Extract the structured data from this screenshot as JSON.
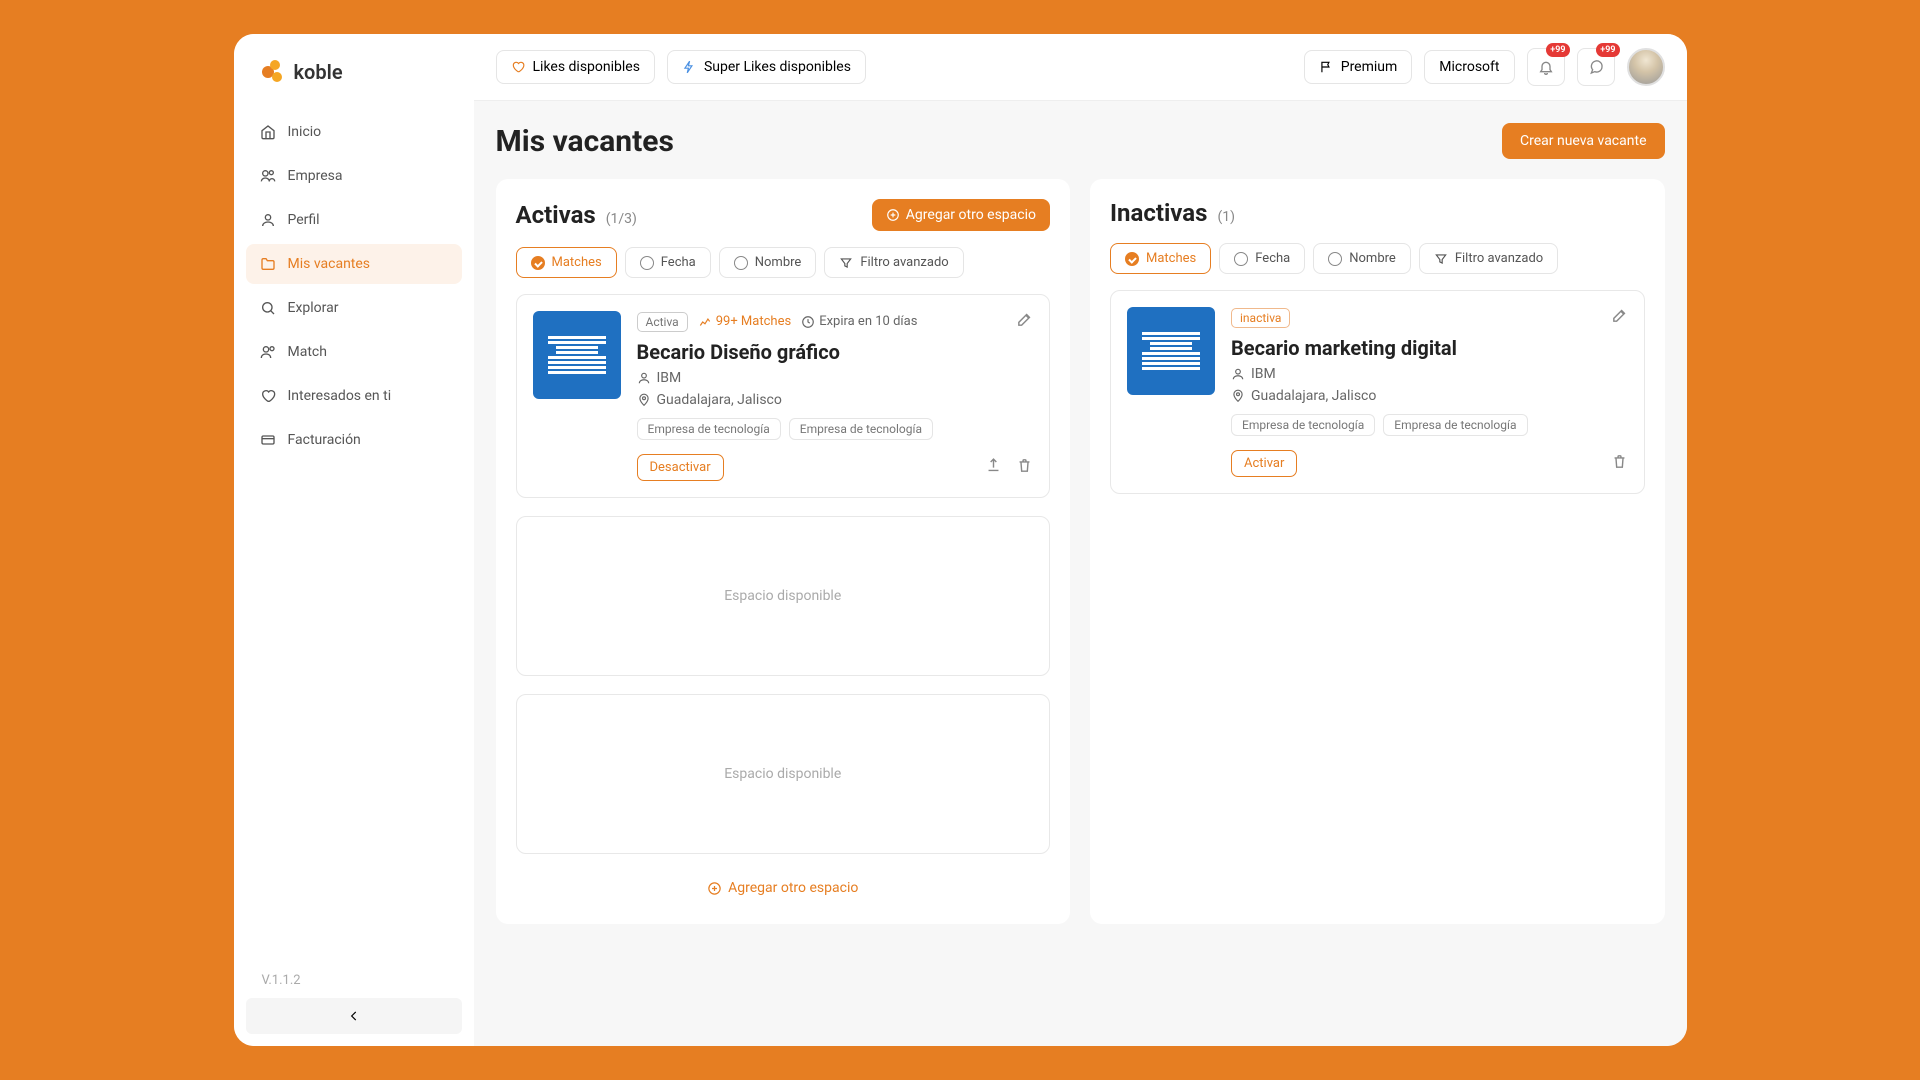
{
  "brand": {
    "name": "koble"
  },
  "sidebar": {
    "items": [
      {
        "label": "Inicio",
        "icon": "home"
      },
      {
        "label": "Empresa",
        "icon": "building"
      },
      {
        "label": "Perfil",
        "icon": "user"
      },
      {
        "label": "Mis vacantes",
        "icon": "folder",
        "active": true
      },
      {
        "label": "Explorar",
        "icon": "search"
      },
      {
        "label": "Match",
        "icon": "users"
      },
      {
        "label": "Interesados en ti",
        "icon": "heart"
      },
      {
        "label": "Facturación",
        "icon": "card"
      }
    ],
    "version": "V.1.1.2"
  },
  "topbar": {
    "likes": "Likes disponibles",
    "superlikes": "Super Likes disponibles",
    "premium": "Premium",
    "company": "Microsoft",
    "notification_badge": "+99",
    "message_badge": "+99"
  },
  "page": {
    "title": "Mis vacantes",
    "create_button": "Crear nueva vacante"
  },
  "filters": {
    "matches": "Matches",
    "date": "Fecha",
    "name": "Nombre",
    "advanced": "Filtro avanzado"
  },
  "panels": {
    "active": {
      "title": "Activas",
      "count": "(1/3)",
      "add_button": "Agregar otro espacio",
      "cards": [
        {
          "status": "Activa",
          "matches": "99+ Matches",
          "expires": "Expira en 10 días",
          "title": "Becario Diseño gráfico",
          "company": "IBM",
          "location": "Guadalajara, Jalisco",
          "tags": [
            "Empresa de tecnología",
            "Empresa de tecnología"
          ],
          "action": "Desactivar"
        }
      ],
      "empty_label": "Espacio disponible",
      "add_link": "Agregar otro espacio"
    },
    "inactive": {
      "title": "Inactivas",
      "count": "(1)",
      "cards": [
        {
          "status": "inactiva",
          "title": "Becario marketing digital",
          "company": "IBM",
          "location": "Guadalajara, Jalisco",
          "tags": [
            "Empresa de tecnología",
            "Empresa de tecnología"
          ],
          "action": "Activar"
        }
      ]
    }
  }
}
